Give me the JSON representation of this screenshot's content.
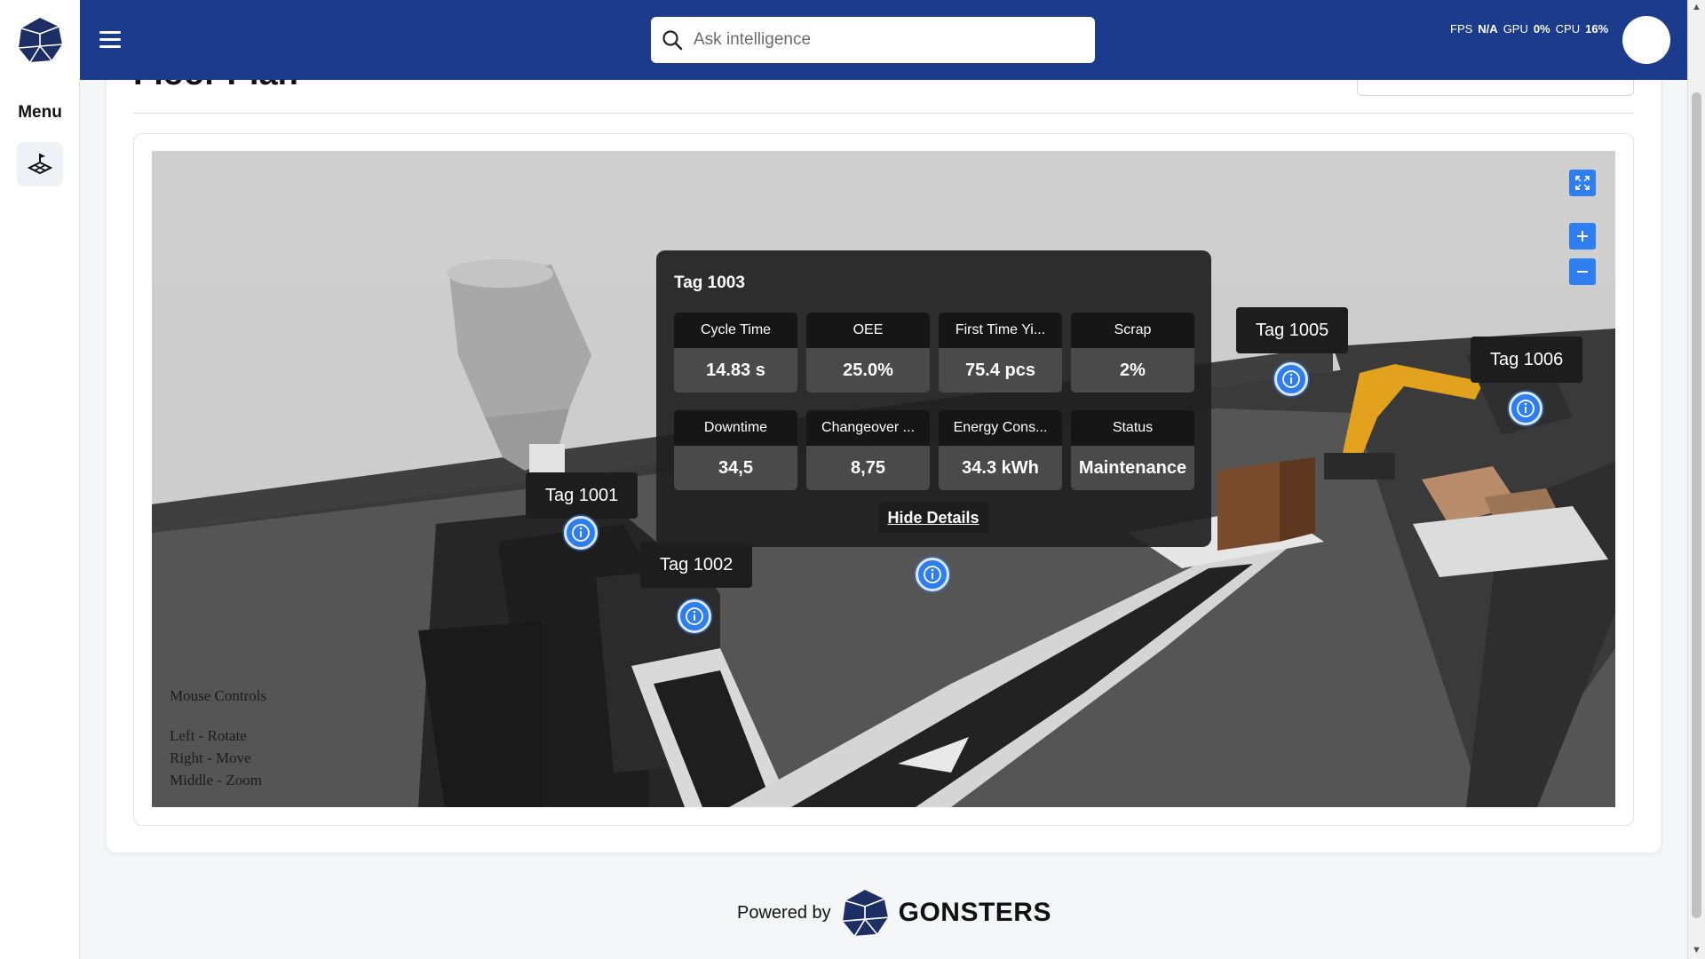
{
  "sidebar": {
    "menu_label": "Menu",
    "items": [
      {
        "icon": "floor-plan-icon"
      }
    ]
  },
  "header": {
    "search_placeholder": "Ask intelligence",
    "stats": {
      "fps_label": "FPS",
      "fps_value": "N/A",
      "gpu_label": "GPU",
      "gpu_value": "0%",
      "cpu_label": "CPU",
      "cpu_value": "16%"
    }
  },
  "page": {
    "title": "Floor Plan"
  },
  "viewer": {
    "tags": [
      {
        "label": "Tag 1001"
      },
      {
        "label": "Tag 1002"
      },
      {
        "label": "Tag 1003"
      },
      {
        "label": "Tag 1005"
      },
      {
        "label": "Tag 1006"
      }
    ],
    "mouse_controls": {
      "title": "Mouse Controls",
      "left": "Left - Rotate",
      "right": "Right - Move",
      "middle": "Middle - Zoom"
    },
    "details": {
      "title": "Tag 1003",
      "metrics": [
        {
          "label": "Cycle Time",
          "value": "14.83 s"
        },
        {
          "label": "OEE",
          "value": "25.0%"
        },
        {
          "label": "First Time Yi...",
          "value": "75.4 pcs"
        },
        {
          "label": "Scrap",
          "value": "2%"
        },
        {
          "label": "Downtime",
          "value": "34,5"
        },
        {
          "label": "Changeover ...",
          "value": "8,75"
        },
        {
          "label": "Energy Cons...",
          "value": "34.3 kWh"
        },
        {
          "label": "Status",
          "value": "Maintenance"
        }
      ],
      "hide_label": "Hide Details"
    }
  },
  "footer": {
    "powered_by": "Powered by",
    "brand": "GONSTERS"
  },
  "colors": {
    "header": "#1c3b8c",
    "accent": "#2f7ef0",
    "popup": "#202020"
  }
}
